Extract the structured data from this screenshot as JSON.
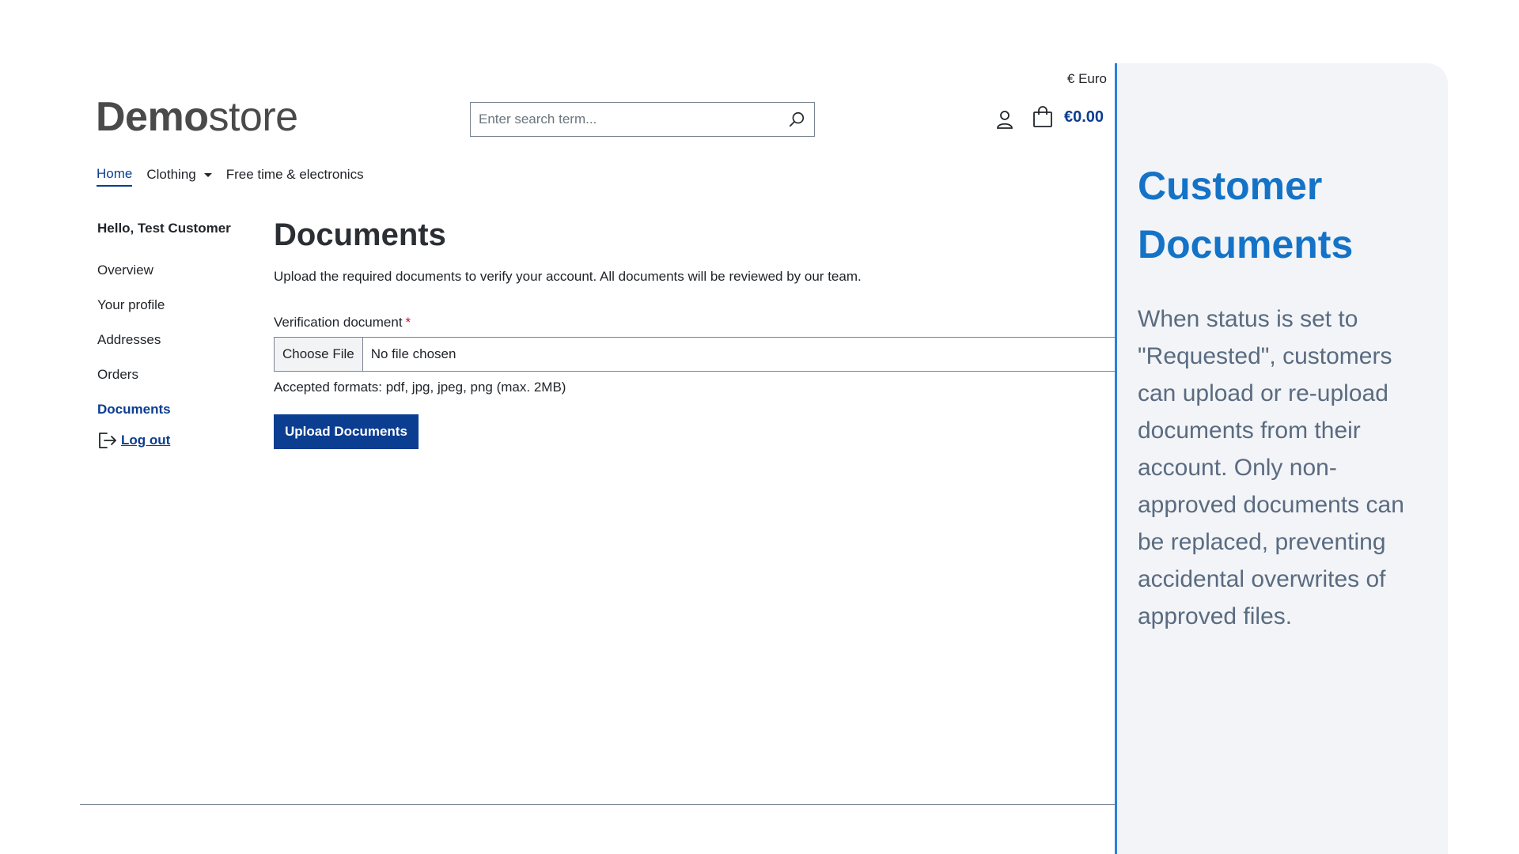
{
  "header": {
    "currency": "€ Euro",
    "logo_bold": "Demo",
    "logo_light": "store",
    "search_placeholder": "Enter search term...",
    "cart_total": "€0.00"
  },
  "nav": {
    "items": [
      {
        "label": "Home",
        "active": true
      },
      {
        "label": "Clothing",
        "dropdown": true
      },
      {
        "label": "Free time & electronics"
      }
    ]
  },
  "sidebar": {
    "greeting": "Hello, Test Customer",
    "items": [
      {
        "label": "Overview"
      },
      {
        "label": "Your profile"
      },
      {
        "label": "Addresses"
      },
      {
        "label": "Orders"
      },
      {
        "label": "Documents",
        "active": true
      }
    ],
    "logout_label": "Log out"
  },
  "main": {
    "title": "Documents",
    "intro": "Upload the required documents to verify your account. All documents will be reviewed by our team.",
    "field_label": "Verification document",
    "required_mark": "*",
    "choose_file_label": "Choose File",
    "no_file_label": "No file chosen",
    "help_text": "Accepted formats: pdf, jpg, jpeg, png (max. 2MB)",
    "upload_button": "Upload Documents"
  },
  "panel": {
    "title_line1": "Customer",
    "title_line2": "Documents",
    "description": "When status is set to \"Requested\", customers can upload or re-upload documents from their account. Only non-approved documents can be replaced, preventing accidental overwrites of approved files."
  },
  "colors": {
    "brand_blue": "#0b3d91",
    "panel_title": "#1473c7",
    "panel_bg": "#f2f4f7",
    "divider": "#2f7fd6",
    "required": "#c8102e"
  },
  "icons": {
    "search": "search-icon",
    "account": "user-icon",
    "cart": "shopping-bag-icon",
    "logout": "logout-icon",
    "dropdown": "caret-down-icon"
  }
}
